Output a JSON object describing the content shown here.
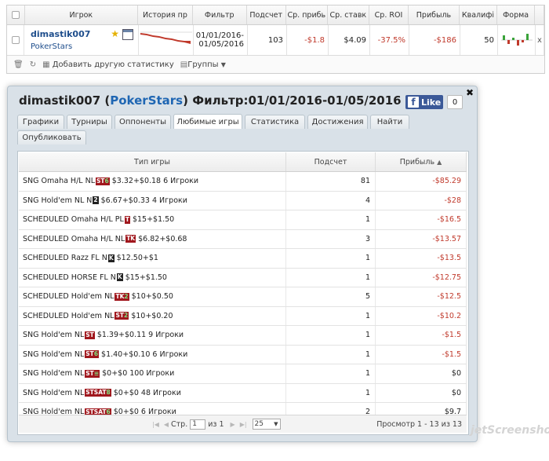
{
  "top_table": {
    "headers": [
      "Игрок",
      "История пр",
      "Фильтр",
      "Подсчет",
      "Ср. прибь",
      "Ср. ставк",
      "Ср. ROI",
      "Прибыль",
      "Квалифі",
      "Форма"
    ],
    "row": {
      "player": "dimastik007",
      "site": "PokerStars",
      "filter_from": "01/01/2016-",
      "filter_to": "01/05/2016",
      "count": "103",
      "avg_profit": "-$1.8",
      "avg_stake": "$4.09",
      "avg_roi": "-37.5%",
      "profit": "-$186",
      "qualif": "50",
      "remove": "x"
    },
    "toolbar": {
      "add_stat": "Добавить другую статистику",
      "groups": "Группы"
    }
  },
  "dialog": {
    "title_prefix": "dimastik007 (",
    "site": "PokerStars",
    "title_suffix": ") Фильтр:01/01/2016-01/05/2016",
    "fb_like": "Like",
    "fb_count": "0",
    "tabs": [
      "Графики",
      "Турниры",
      "Оппоненты",
      "Любимые игры",
      "Статистика",
      "Достижения",
      "Найти",
      "Опубликовать"
    ],
    "active_tab": "Любимые игры",
    "columns": [
      "Тип игры",
      "Подсчет",
      "Прибыль"
    ],
    "rows": [
      {
        "pre": "SNG Omaha H/L NL",
        "badge": "ST",
        "badge_sub": "6",
        "post": "$3.32+$0.18 6 Игроки",
        "count": "81",
        "profit": "-$85.29",
        "neg": true
      },
      {
        "pre": "SNG Hold'em NL N",
        "badge": "2",
        "badge_sub": "",
        "post": "$6.67+$0.33 4 Игроки",
        "count": "4",
        "profit": "-$28",
        "neg": true
      },
      {
        "pre": "SCHEDULED Omaha H/L PL",
        "badge": "T",
        "badge_sub": "",
        "post": "$15+$1.50",
        "count": "1",
        "profit": "-$16.5",
        "neg": true
      },
      {
        "pre": "SCHEDULED Omaha H/L NL",
        "badge": "TK",
        "badge_sub": "",
        "post": "$6.82+$0.68",
        "count": "3",
        "profit": "-$13.57",
        "neg": true
      },
      {
        "pre": "SCHEDULED Razz FL N",
        "badge": "K",
        "badge_sub": "",
        "post": "$12.50+$1",
        "count": "1",
        "profit": "-$13.5",
        "neg": true
      },
      {
        "pre": "SCHEDULED HORSE FL N",
        "badge": "K",
        "badge_sub": "",
        "post": "$15+$1.50",
        "count": "1",
        "profit": "-$12.75",
        "neg": true
      },
      {
        "pre": "SCHEDULED Hold'em NL",
        "badge": "TK",
        "badge_sub": "2",
        "post": "$10+$0.50",
        "count": "5",
        "profit": "-$12.5",
        "neg": true
      },
      {
        "pre": "SCHEDULED Hold'em NL",
        "badge": "ST",
        "badge_sub": "2",
        "post": "$10+$0.20",
        "count": "1",
        "profit": "-$10.2",
        "neg": true
      },
      {
        "pre": "SNG Hold'em NL",
        "badge": "ST",
        "badge_sub": "",
        "post": "$1.39+$0.11 9 Игроки",
        "count": "1",
        "profit": "-$1.5",
        "neg": true
      },
      {
        "pre": "SNG Hold'em NL",
        "badge": "ST",
        "badge_sub": "6",
        "post": "$1.40+$0.10 6 Игроки",
        "count": "1",
        "profit": "-$1.5",
        "neg": true
      },
      {
        "pre": "SNG Hold'em NL",
        "badge": "ST",
        "badge_sub": "≡",
        "post": "$0+$0 100 Игроки",
        "count": "1",
        "profit": "$0",
        "neg": false
      },
      {
        "pre": "SNG Hold'em NL",
        "badge": "STSAT",
        "badge_sub": "8",
        "post": "$0+$0 48 Игроки",
        "count": "1",
        "profit": "$0",
        "neg": false
      },
      {
        "pre": "SNG Hold'em NL",
        "badge": "STSAT",
        "badge_sub": "6",
        "post": "$0+$0 6 Игроки",
        "count": "2",
        "profit": "$9.7",
        "neg": false
      }
    ],
    "pager": {
      "page_label": "Стр.",
      "page_value": "1",
      "of_label": "из 1",
      "per_page": "25",
      "info": "Просмотр 1 - 13 из 13"
    }
  },
  "watermark": "jetScreenshot",
  "colors": {
    "negative": "#c0392b",
    "link": "#1f66b3",
    "badge": "#a0171d"
  }
}
